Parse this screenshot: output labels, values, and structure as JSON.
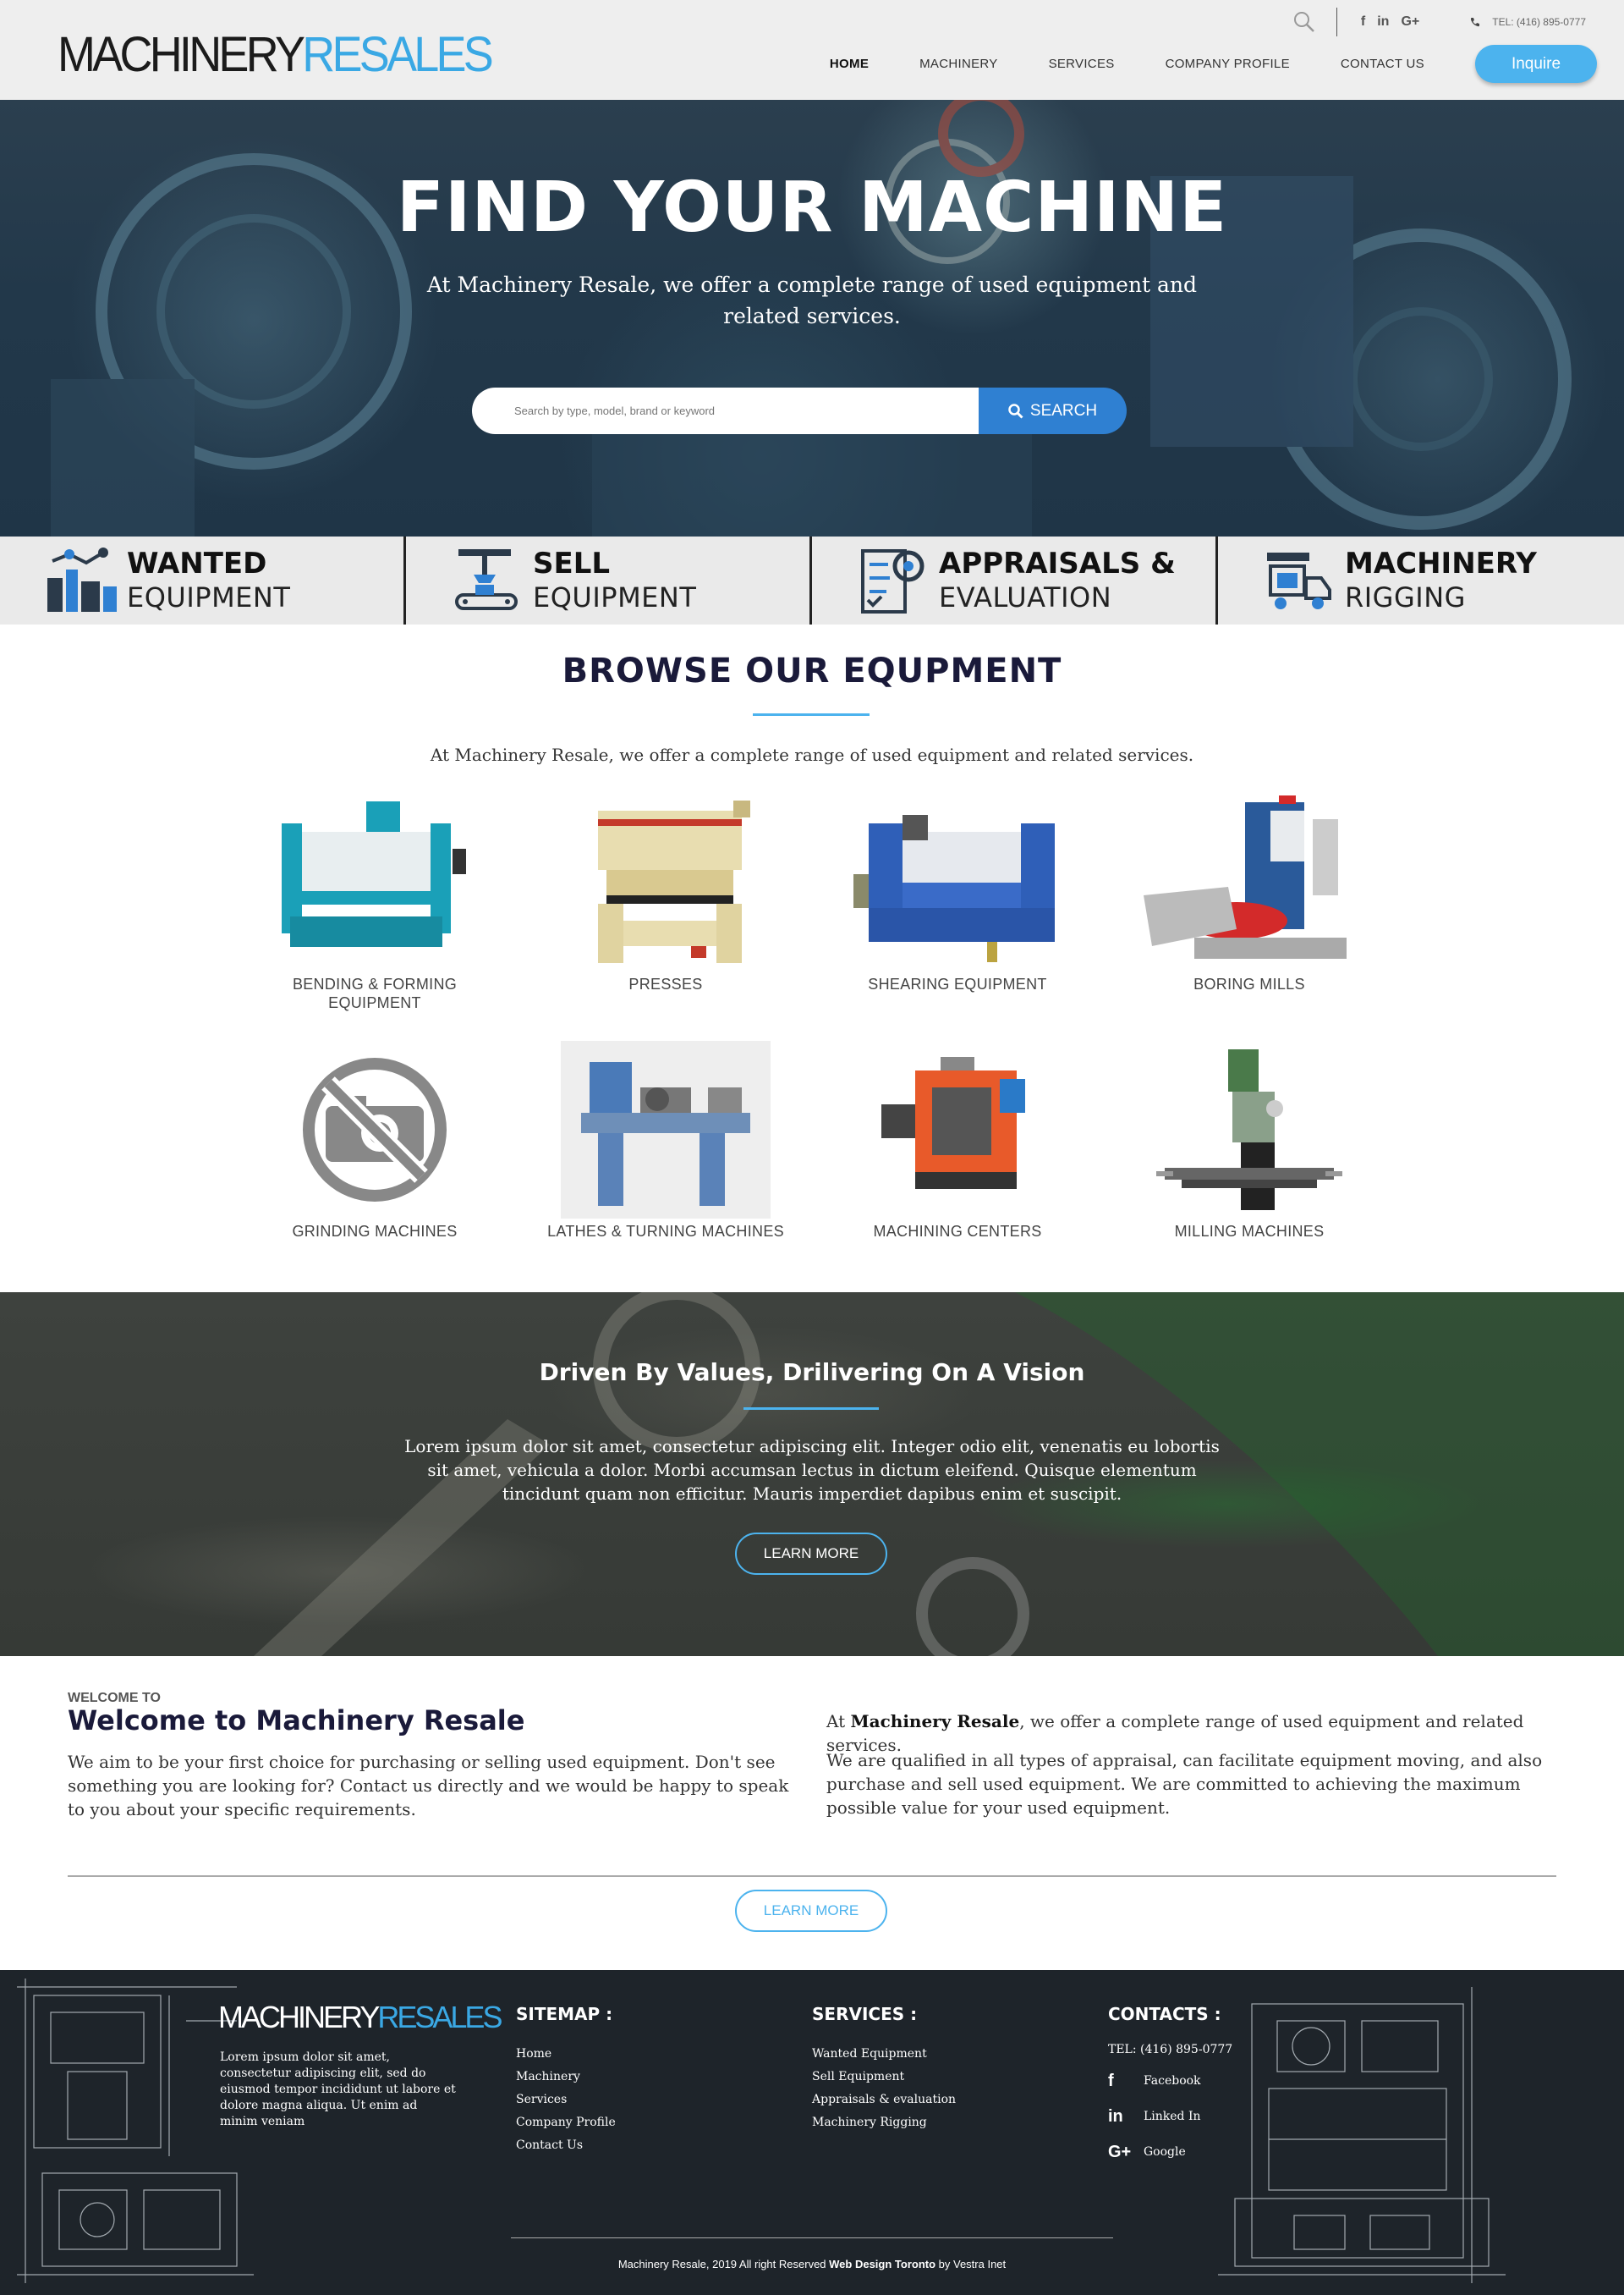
{
  "header": {
    "logo_part1": "MACHINERY",
    "logo_part2": "RESALES",
    "social": [
      "f",
      "in",
      "G+"
    ],
    "tel": "TEL: (416) 895-0777",
    "nav": [
      "HOME",
      "MACHINERY",
      "SERVICES",
      "COMPANY PROFILE",
      "CONTACT US"
    ],
    "inquire": "Inquire"
  },
  "hero": {
    "title": "FIND YOUR MACHINE",
    "subtitle": "At Machinery Resale, we offer a complete range of used equipment and related services.",
    "search_placeholder": "Search by type, model, brand or keyword",
    "search_button": "SEARCH"
  },
  "services_strip": [
    {
      "bold": "WANTED",
      "light": "EQUIPMENT",
      "icon": "wanted-equipment-icon"
    },
    {
      "bold": "SELL",
      "light": "EQUIPMENT",
      "icon": "sell-equipment-icon"
    },
    {
      "bold": "APPRAISALS &",
      "light": "EVALUATION",
      "icon": "appraisal-icon"
    },
    {
      "bold": "MACHINERY",
      "light": "RIGGING",
      "icon": "rigging-truck-icon"
    }
  ],
  "browse": {
    "title": "BROWSE OUR EQUPMENT",
    "subtitle": "At Machinery Resale, we offer a complete range of used equipment and related services.",
    "items": [
      {
        "label": "BENDING & FORMING EQUIPMENT"
      },
      {
        "label": "PRESSES"
      },
      {
        "label": "SHEARING EQUIPMENT"
      },
      {
        "label": "BORING MILLS"
      },
      {
        "label": "GRINDING MACHINES"
      },
      {
        "label": "LATHES & TURNING MACHINES"
      },
      {
        "label": "MACHINING CENTERS"
      },
      {
        "label": "MILLING MACHINES"
      }
    ]
  },
  "values": {
    "title": "Driven By Values, Drilivering On A Vision",
    "text": "Lorem ipsum dolor sit amet, consectetur adipiscing elit. Integer odio elit, venenatis eu lobortis sit amet, vehicula a dolor. Morbi accumsan lectus in dictum eleifend. Quisque elementum tincidunt quam non efficitur. Mauris imperdiet dapibus enim et suscipit.",
    "button": "LEARN MORE"
  },
  "welcome": {
    "eyebrow": "WELCOME TO",
    "title": "Welcome to Machinery Resale",
    "left_text": "We aim to be your first choice for purchasing or selling used equipment. Don't see something you are looking for? Contact us directly and we would be happy to speak to you about your specific requirements.",
    "right_pre": "At ",
    "right_bold": "Machinery Resale",
    "right_post": ", we offer a complete range of used equipment and related services.",
    "right_text2": "We are qualified in all types of appraisal, can facilitate equipment moving, and also purchase and sell used equipment. We are committed to achieving the maximum possible value for your used equipment.",
    "button": "LEARN MORE"
  },
  "footer": {
    "logo_part1": "MACHINERY",
    "logo_part2": "RESALES",
    "about": "Lorem ipsum dolor sit amet, consectetur adipiscing elit, sed do eiusmod tempor incididunt ut labore et dolore magna aliqua. Ut enim ad minim veniam",
    "sitemap_title": "SITEMAP :",
    "sitemap": [
      "Home",
      "Machinery",
      "Services",
      "Company Profile",
      "Contact Us"
    ],
    "services_title": "SERVICES :",
    "services": [
      "Wanted Equipment",
      "Sell Equipment",
      "Appraisals & evaluation",
      "Machinery Rigging"
    ],
    "contacts_title": "CONTACTS :",
    "tel": "TEL: (416) 895-0777",
    "contacts": [
      {
        "icon": "f",
        "label": "Facebook"
      },
      {
        "icon": "in",
        "label": "Linked In"
      },
      {
        "icon": "G+",
        "label": "Google"
      }
    ],
    "copy_pre": "Machinery Resale, 2019 All right Reserved ",
    "copy_bold": "Web Design Toronto",
    "copy_post": " by Vestra Inet"
  },
  "colors": {
    "accent": "#4cb3ee",
    "search_button": "#2f80d2",
    "header_bg": "#eeeeee",
    "footer_bg": "#1e242a",
    "heading": "#1a1a3a"
  }
}
